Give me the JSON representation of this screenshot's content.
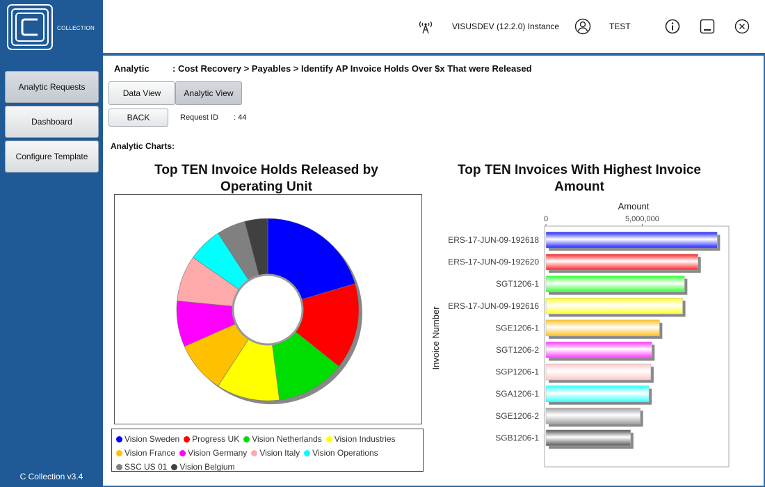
{
  "app": {
    "logo_text": "COLLECTION",
    "version": "C Collection v3.4"
  },
  "sidebar": {
    "items": [
      {
        "label": "Analytic Requests",
        "active": true
      },
      {
        "label": "Dashboard",
        "active": false
      },
      {
        "label": "Configure Template",
        "active": false
      }
    ]
  },
  "header": {
    "instance": "VISUSDEV (12.2.0) Instance",
    "user": "TEST",
    "icons": [
      "antenna-icon",
      "user-icon",
      "info-icon",
      "minimize-icon",
      "close-icon"
    ]
  },
  "main": {
    "breadcrumb_label": "Analytic",
    "breadcrumb_path": ": Cost Recovery > Payables > Identify AP Invoice Holds Over $x That were Released",
    "tabs": [
      {
        "label": "Data View",
        "active": false
      },
      {
        "label": "Analytic View",
        "active": true
      }
    ],
    "back_label": "BACK",
    "request_id_label": "Request ID",
    "request_id_value": ":  44",
    "charts_label": "Analytic Charts:"
  },
  "chart_data": [
    {
      "type": "pie",
      "title_line1": "Top TEN Invoice Holds Released by",
      "title_line2": "Operating Unit",
      "categories": [
        "Vision Sweden",
        "Progress UK",
        "Vision Netherlands",
        "Vision Industries",
        "Vision France",
        "Vision Germany",
        "Vision Italy",
        "Vision Operations",
        "SSC US 01",
        "Vision Belgium"
      ],
      "values": [
        20,
        15,
        12,
        11,
        9,
        8,
        8,
        6,
        5,
        4
      ],
      "colors": [
        "#0000ff",
        "#ff0000",
        "#00dd00",
        "#ffff00",
        "#ffc000",
        "#ff00ff",
        "#ffaaaa",
        "#00ffff",
        "#808080",
        "#404040"
      ],
      "legend_position": "bottom"
    },
    {
      "type": "bar",
      "orientation": "horizontal",
      "title_line1": "Top TEN Invoices With Highest Invoice",
      "title_line2": "Amount",
      "xlabel": "Amount",
      "ylabel": "Invoice Number",
      "xticks": [
        "0",
        "5,000,000"
      ],
      "xlim": [
        0,
        9500000
      ],
      "categories": [
        "ERS-17-JUN-09-192618",
        "ERS-17-JUN-09-192620",
        "SGT1206-1",
        "ERS-17-JUN-09-192616",
        "SGE1206-1",
        "SGT1206-2",
        "SGP1206-1",
        "SGA1206-1",
        "SGE1206-2",
        "SGB1206-1"
      ],
      "values": [
        8900000,
        7900000,
        7200000,
        7100000,
        5900000,
        5500000,
        5450000,
        5350000,
        4900000,
        4400000
      ],
      "colors": [
        "#2222ff",
        "#ff2020",
        "#33ff33",
        "#ffff22",
        "#ffc020",
        "#ff33ff",
        "#ffc8c8",
        "#33ffff",
        "#a0a0a0",
        "#555555"
      ]
    }
  ]
}
